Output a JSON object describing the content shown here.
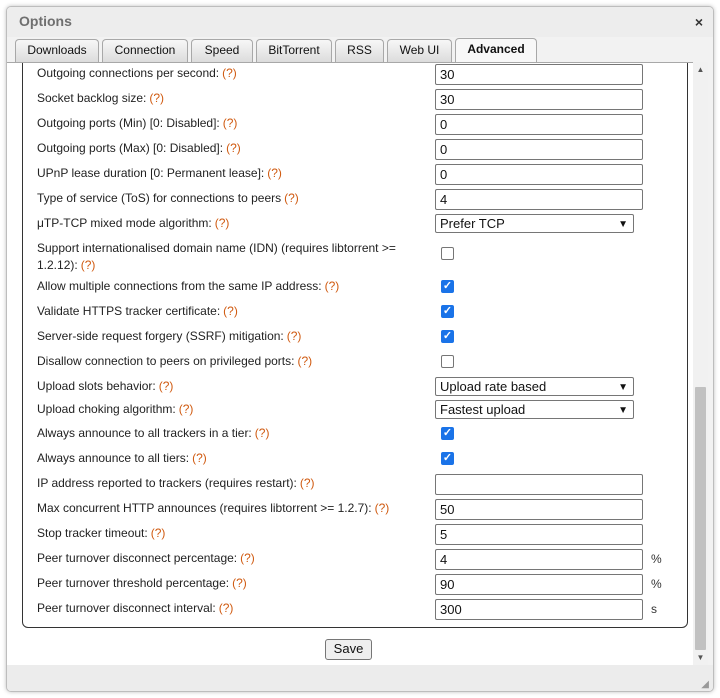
{
  "dialog": {
    "title": "Options",
    "close_glyph": "×"
  },
  "tabs": [
    "Downloads",
    "Connection",
    "Speed",
    "BitTorrent",
    "RSS",
    "Web UI",
    "Advanced"
  ],
  "help_text": "(?)",
  "rows": [
    {
      "label": "Outgoing connections per second:",
      "value": "30"
    },
    {
      "label": "Socket backlog size:",
      "value": "30"
    },
    {
      "label": "Outgoing ports (Min) [0: Disabled]:",
      "value": "0"
    },
    {
      "label": "Outgoing ports (Max) [0: Disabled]:",
      "value": "0"
    },
    {
      "label": "UPnP lease duration [0: Permanent lease]:",
      "value": "0"
    },
    {
      "label": "Type of service (ToS) for connections to peers",
      "value": "4"
    },
    {
      "label": "μTP-TCP mixed mode algorithm:",
      "value": "Prefer TCP"
    },
    {
      "label": "Support internationalised domain name (IDN) (requires libtorrent >= 1.2.12):",
      "checked": false
    },
    {
      "label": "Allow multiple connections from the same IP address:",
      "checked": true
    },
    {
      "label": "Validate HTTPS tracker certificate:",
      "checked": true
    },
    {
      "label": "Server-side request forgery (SSRF) mitigation:",
      "checked": true
    },
    {
      "label": "Disallow connection to peers on privileged ports:",
      "checked": false
    },
    {
      "label": "Upload slots behavior:",
      "value": "Upload rate based"
    },
    {
      "label": "Upload choking algorithm:",
      "value": "Fastest upload"
    },
    {
      "label": "Always announce to all trackers in a tier:",
      "checked": true
    },
    {
      "label": "Always announce to all tiers:",
      "checked": true
    },
    {
      "label": "IP address reported to trackers (requires restart):",
      "value": ""
    },
    {
      "label": "Max concurrent HTTP announces (requires libtorrent >= 1.2.7):",
      "value": "50"
    },
    {
      "label": "Stop tracker timeout:",
      "value": "5"
    },
    {
      "label": "Peer turnover disconnect percentage:",
      "value": "4",
      "unit": "%"
    },
    {
      "label": "Peer turnover threshold percentage:",
      "value": "90",
      "unit": "%"
    },
    {
      "label": "Peer turnover disconnect interval:",
      "value": "300",
      "unit": "s"
    }
  ],
  "save_label": "Save",
  "colors": {
    "help": "#d05a10",
    "checkbox": "#1a73e8"
  }
}
